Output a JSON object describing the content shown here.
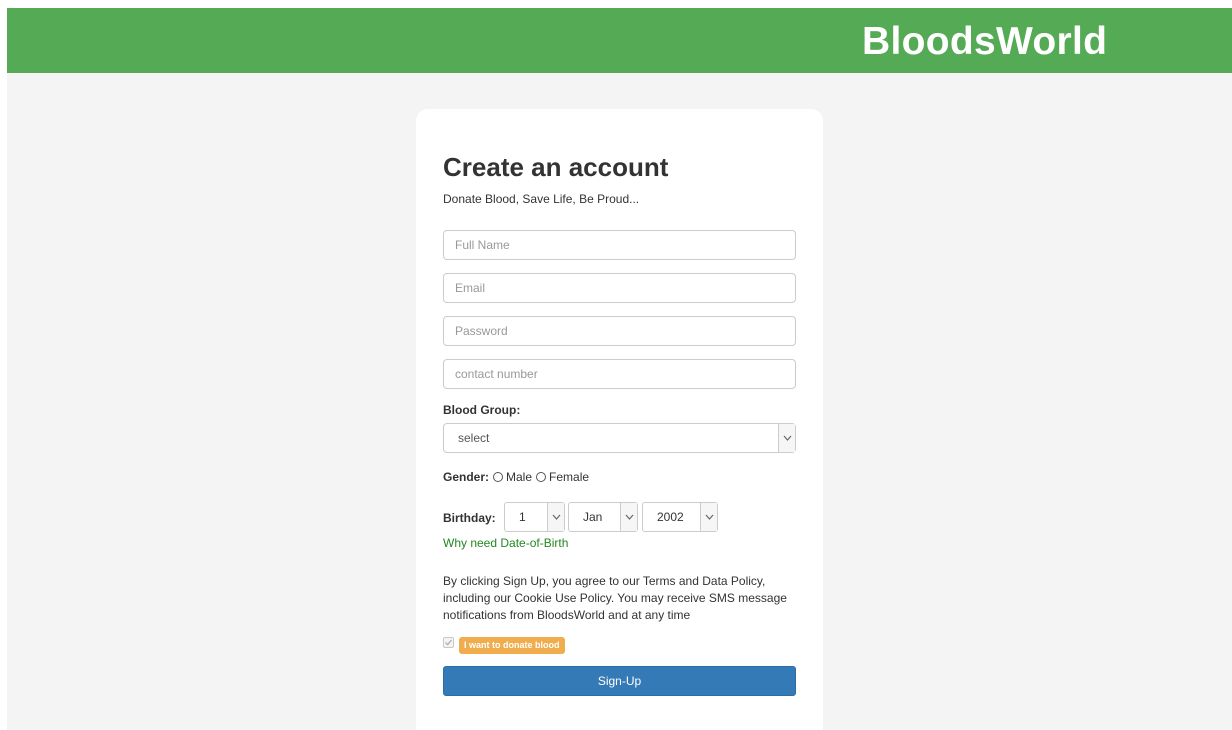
{
  "header": {
    "brand": "BloodsWorld",
    "background_color": "#55aa55"
  },
  "form": {
    "title": "Create an account",
    "subtitle": "Donate Blood, Save Life, Be Proud...",
    "full_name_placeholder": "Full Name",
    "email_placeholder": "Email",
    "password_placeholder": "Password",
    "contact_placeholder": "contact number",
    "blood_group_label": "Blood Group:",
    "blood_group_selected": "select",
    "gender_label": "Gender:",
    "gender_options": [
      "Male",
      "Female"
    ],
    "birthday_label": "Birthday:",
    "birthday_day": "1",
    "birthday_month": "Jan",
    "birthday_year": "2002",
    "why_dob_link": "Why need Date-of-Birth",
    "terms_text": "By clicking Sign Up, you agree to our Terms and Data Policy, including our Cookie Use Policy. You may receive SMS message notifications from BloodsWorld and at any time",
    "donate_checkbox_checked": true,
    "donate_badge": "I want to donate blood",
    "signup_button": "Sign-Up"
  },
  "colors": {
    "accent_green": "#55aa55",
    "link_green": "#228822",
    "badge_orange": "#f0ad4e",
    "button_blue": "#337ab7"
  }
}
